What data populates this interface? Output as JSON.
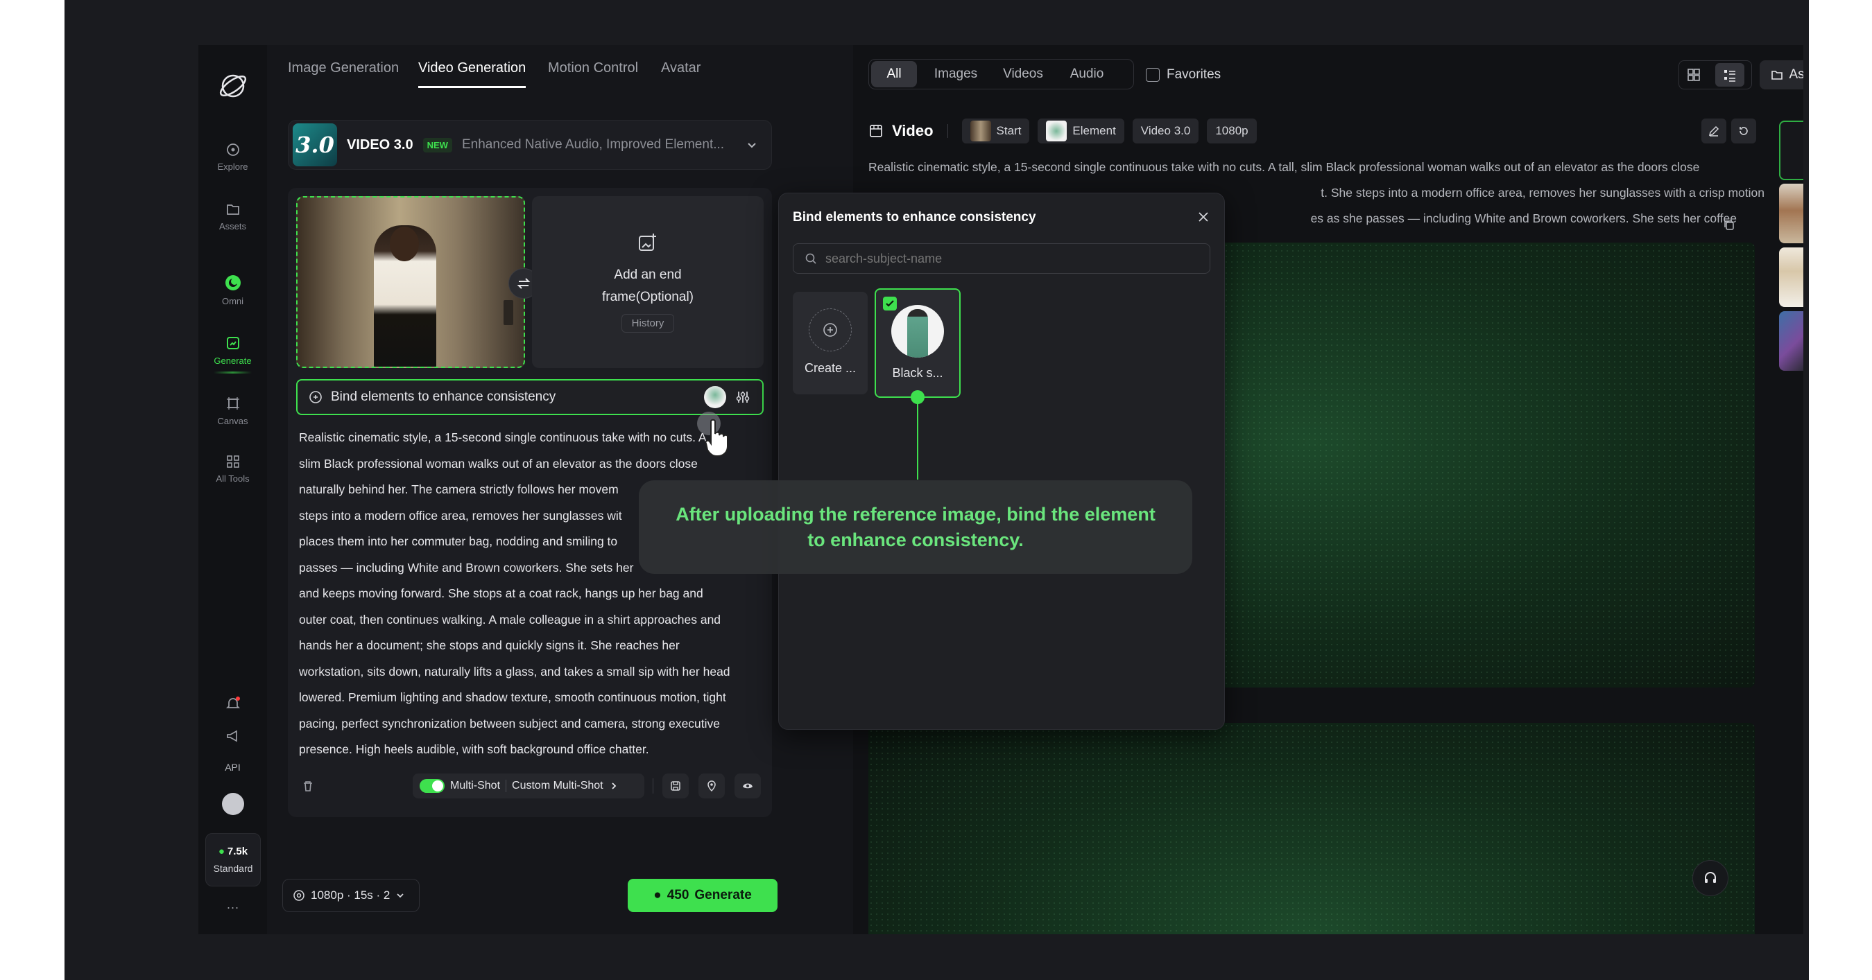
{
  "rail": {
    "items": [
      {
        "label": "Explore",
        "icon": "compass-icon"
      },
      {
        "label": "Assets",
        "icon": "folder-icon"
      },
      {
        "label": "Omni",
        "icon": "omni-icon"
      },
      {
        "label": "Generate",
        "icon": "generate-icon"
      },
      {
        "label": "Canvas",
        "icon": "canvas-icon"
      },
      {
        "label": "All Tools",
        "icon": "grid-icon"
      }
    ],
    "api_label": "API",
    "credits": "7.5k",
    "plan": "Standard",
    "more": "···"
  },
  "tabs": [
    "Image Generation",
    "Video Generation",
    "Motion Control",
    "Avatar"
  ],
  "model": {
    "badge": "3.0",
    "name": "VIDEO 3.0",
    "new_tag": "NEW",
    "description": "Enhanced Native Audio, Improved Element..."
  },
  "frames": {
    "end_frame_label": "Add an end frame(Optional)",
    "history": "History"
  },
  "bind": {
    "label": "Bind elements to enhance consistency"
  },
  "prompt": "Realistic cinematic style, a 15-second single continuous take with no cuts. A tall, slim Black professional woman walks out of an elevator as the doors close naturally behind her. The camera strictly follows her movement. She steps into a modern office area, removes her sunglasses with a crisp motion, places them into her commuter bag, nodding and smiling to colleagues as she passes — including White and Brown coworkers. She sets her coffee down and keeps moving forward. She stops at a coat rack, hangs up her bag and outer coat, then continues walking. A male colleague in a shirt approaches and hands her a document; she stops and quickly signs it. She reaches her workstation, sits down, naturally lifts a glass, and takes a small sip with her head lowered. Premium lighting and shadow texture, smooth continuous motion, tight pacing, perfect synchronization between subject and camera, strong executive presence. High heels audible, with soft background office chatter.",
  "prompt_lines": [
    "Realistic cinematic style, a 15-second single continuous take with no cuts. A",
    "slim Black professional woman walks out of an elevator as the doors close",
    "naturally behind her. The camera strictly follows her movem",
    "steps into a modern office area, removes her sunglasses wit",
    "places them into her commuter bag, nodding and smiling to",
    "passes — including White and Brown coworkers. She sets her",
    "and keeps moving forward. She stops at a coat rack, hangs up her bag and",
    "outer coat, then continues walking. A male colleague in a shirt approaches and",
    "hands her a document; she stops and quickly signs it. She reaches her",
    "workstation, sits down, naturally lifts a glass, and takes a small sip with her head",
    "lowered. Premium lighting and shadow texture, smooth continuous motion, tight",
    "pacing, perfect synchronization between subject and camera, strong executive",
    "presence. High heels audible, with soft background office chatter."
  ],
  "toolbar": {
    "multishot": "Multi-Shot",
    "custom_multishot": "Custom Multi-Shot"
  },
  "footer": {
    "settings": "1080p · 15s · 2",
    "cost": "450",
    "generate": "Generate"
  },
  "filters": [
    "All",
    "Images",
    "Videos",
    "Audio"
  ],
  "favorites": "Favorites",
  "assets_button": "Assets",
  "video": {
    "title": "Video",
    "chips": [
      "Start",
      "Element",
      "Video 3.0",
      "1080p"
    ],
    "prompt_lines": [
      "Realistic cinematic style, a 15-second single continuous take with no cuts. A tall, slim Black professional woman walks out of an elevator as the doors close",
      "t. She steps into a modern office area, removes her sunglasses with a crisp motion",
      "es as she passes — including White and Brown coworkers. She sets her coffee"
    ]
  },
  "popup": {
    "title": "Bind elements to enhance consistency",
    "search_placeholder": "search-subject-name",
    "create_label": "Create ...",
    "element_label": "Black s..."
  },
  "tooltip": {
    "line1": "After uploading the reference image, bind the element",
    "line2": "to enhance consistency."
  },
  "colors": {
    "accent": "#3ee04e",
    "bg": "#111215",
    "panel": "#1c1d22"
  }
}
